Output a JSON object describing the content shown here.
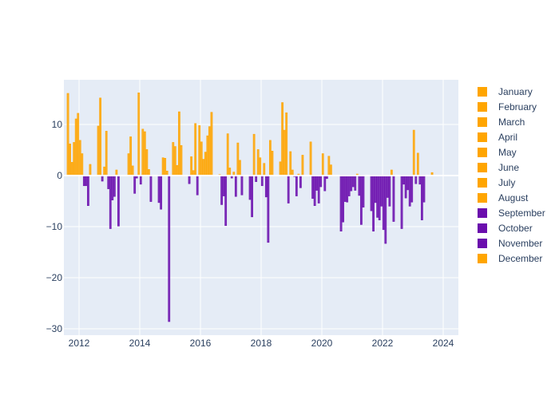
{
  "chart_data": {
    "type": "bar",
    "barmode": "group",
    "title": "",
    "xlabel": "",
    "ylabel": "",
    "x": [
      2012,
      2013,
      2014,
      2015,
      2016,
      2017,
      2018,
      2019,
      2020,
      2021,
      2022,
      2023,
      2024
    ],
    "xlim": [
      2011.5,
      2024.5
    ],
    "ylim": [
      -31.25,
      18.75
    ],
    "xticks": [
      2012,
      2014,
      2016,
      2018,
      2020,
      2022,
      2024
    ],
    "xtick_labels": [
      "2012",
      "2014",
      "2016",
      "2018",
      "2020",
      "2022",
      "2024"
    ],
    "yticks": [
      10,
      0,
      -10,
      -20,
      -30
    ],
    "ytick_labels": [
      "10",
      "0",
      "−10",
      "−20",
      "−30"
    ],
    "grid": true,
    "legend_position": "right",
    "colors": {
      "positive": "#FFA500",
      "negative": "#6A0DAD",
      "plot_bg": "#E5ECF6",
      "grid": "#FFFFFF",
      "text": "#2A3F5F"
    },
    "series": [
      {
        "name": "January",
        "legend_color": "#FFA500",
        "values": [
          16.1,
          9.7,
          4.3,
          -5.3,
          -1.6,
          0.2,
          -4.7,
          2.7,
          6.6,
          -10.9,
          -6.9,
          -10.4,
          0.6
        ]
      },
      {
        "name": "February",
        "legend_color": "#FFA500",
        "values": [
          6.2,
          15.2,
          7.6,
          -6.6,
          3.7,
          -5.7,
          -8.1,
          14.3,
          -4.5,
          -9.1,
          -10.9,
          -1.7,
          null
        ]
      },
      {
        "name": "March",
        "legend_color": "#FFA500",
        "values": [
          2.6,
          -1.1,
          1.9,
          3.5,
          1.0,
          -4.0,
          8.1,
          8.9,
          -5.9,
          -5.1,
          -5.3,
          -4.4,
          null
        ]
      },
      {
        "name": "April",
        "legend_color": "#FFA500",
        "values": [
          6.5,
          1.7,
          -3.5,
          3.4,
          10.2,
          -9.8,
          -1.2,
          12.3,
          -2.9,
          -5.2,
          -8.2,
          -2.8,
          null
        ]
      },
      {
        "name": "May",
        "legend_color": "#FFA500",
        "values": [
          11.1,
          8.7,
          -0.5,
          0.9,
          -3.8,
          8.2,
          5.1,
          -5.4,
          -5.4,
          -4.0,
          -8.7,
          -6.0,
          null
        ]
      },
      {
        "name": "June",
        "legend_color": "#FFA500",
        "values": [
          12.2,
          -2.6,
          16.2,
          -28.6,
          9.8,
          1.5,
          3.5,
          4.7,
          -2.2,
          -3.0,
          -6.0,
          -5.2,
          null
        ]
      },
      {
        "name": "July",
        "legend_color": "#FFA500",
        "values": [
          6.9,
          -10.4,
          -1.7,
          null,
          6.6,
          -0.5,
          -2.0,
          1.1,
          4.3,
          -2.2,
          -10.6,
          8.9,
          null
        ]
      },
      {
        "name": "August",
        "legend_color": "#FFA500",
        "values": [
          4.3,
          -4.8,
          9.1,
          6.5,
          3.2,
          0.7,
          2.4,
          -0.2,
          -3.0,
          -2.9,
          -13.3,
          -1.6,
          null
        ]
      },
      {
        "name": "September",
        "legend_color": "#6A0DAD",
        "values": [
          -2.0,
          -4.1,
          8.6,
          5.7,
          4.6,
          -4.1,
          -4.2,
          -4.0,
          -0.6,
          0.3,
          -4.3,
          4.4,
          null
        ]
      },
      {
        "name": "October",
        "legend_color": "#6A0DAD",
        "values": [
          -2.0,
          1.1,
          5.1,
          2.0,
          7.8,
          6.4,
          -13.1,
          0.3,
          3.8,
          -3.9,
          -6.0,
          -1.7,
          null
        ]
      },
      {
        "name": "November",
        "legend_color": "#6A0DAD",
        "values": [
          -5.9,
          -9.9,
          1.2,
          12.5,
          9.6,
          3.0,
          6.9,
          -2.4,
          2.1,
          -9.6,
          1.1,
          -8.7,
          null
        ]
      },
      {
        "name": "December",
        "legend_color": "#FFA500",
        "values": [
          2.2,
          null,
          -5.1,
          5.9,
          12.4,
          -3.8,
          4.8,
          4.0,
          0.1,
          -6.2,
          -9.0,
          -5.2,
          null
        ]
      }
    ]
  }
}
